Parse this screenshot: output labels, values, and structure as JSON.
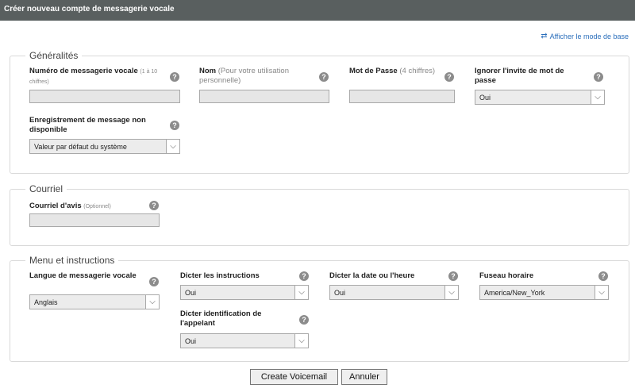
{
  "window": {
    "title": "Créer nouveau compte de messagerie vocale"
  },
  "basic_mode_link": "Afficher le mode de base",
  "help_glyph": "?",
  "sections": {
    "general": {
      "legend": "Généralités",
      "mailbox_number": {
        "label": "Numéro de messagerie vocale",
        "hint": "(1 à 10 chiffres)",
        "value": ""
      },
      "name": {
        "label": "Nom",
        "hint": "(Pour votre utilisation personnelle)",
        "value": ""
      },
      "password": {
        "label": "Mot de Passe",
        "hint": "(4 chiffres)",
        "value": ""
      },
      "skip_password": {
        "label": "Ignorer l'invite de mot de passe",
        "selected": "Oui"
      },
      "unavailable_recording": {
        "label": "Enregistrement de message non disponible",
        "selected": "Valeur par défaut du système"
      }
    },
    "email": {
      "legend": "Courriel",
      "notify_email": {
        "label": "Courriel d'avis",
        "hint": "(Optionnel)",
        "value": ""
      }
    },
    "menu": {
      "legend": "Menu et instructions",
      "language": {
        "label": "Langue de messagerie vocale",
        "selected": "Anglais"
      },
      "say_instructions": {
        "label": "Dicter les instructions",
        "selected": "Oui"
      },
      "say_datetime": {
        "label": "Dicter la date ou l'heure",
        "selected": "Oui"
      },
      "timezone": {
        "label": "Fuseau horaire",
        "selected": "America/New_York"
      },
      "say_callerid": {
        "label": "Dicter identification de l'appelant",
        "selected": "Oui"
      }
    }
  },
  "buttons": {
    "create": "Create Voicemail",
    "cancel": "Annuler"
  }
}
